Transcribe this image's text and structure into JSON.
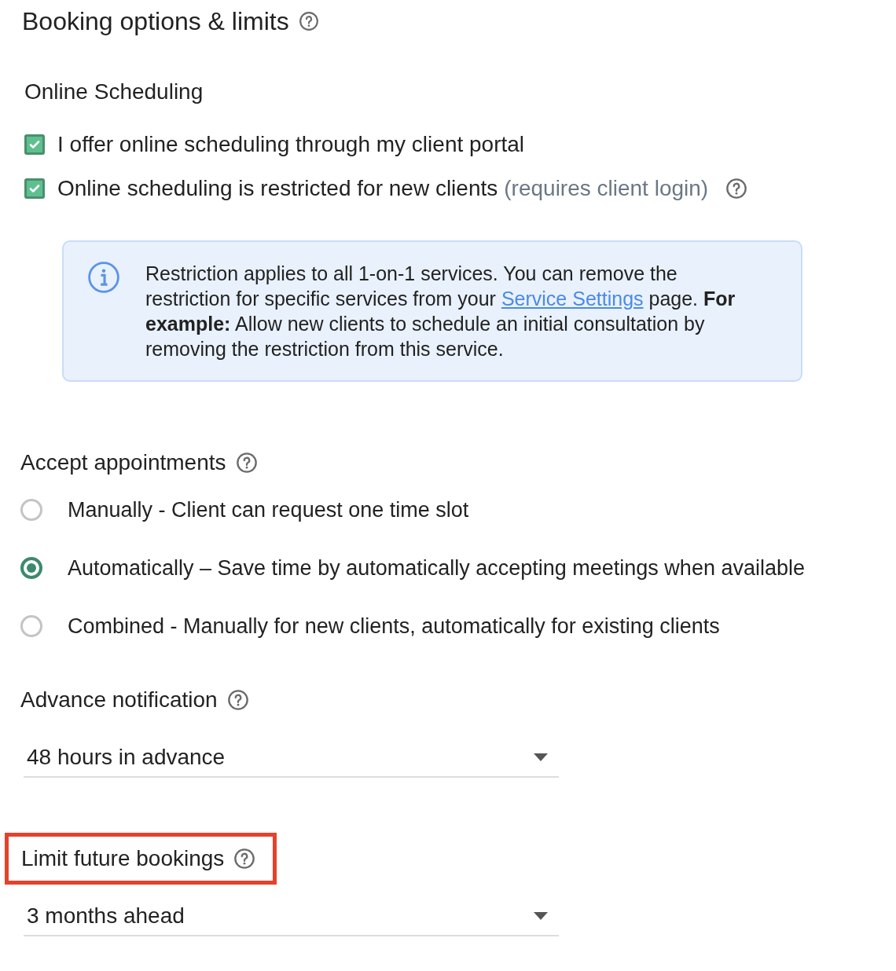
{
  "title": "Booking options & limits",
  "title_help": true,
  "online_scheduling": {
    "heading": "Online Scheduling",
    "checkboxes": [
      {
        "label": "I offer online scheduling through my client portal",
        "checked": true,
        "help": false
      },
      {
        "label": "Online scheduling is restricted for new clients",
        "note": "(requires client login)",
        "checked": true,
        "help": true
      }
    ],
    "info": {
      "text_before": "Restriction applies to all 1-on-1 services. You can remove the restriction for specific services from your",
      "link": "Service Settings",
      "text_after": "page. **For example:** Allow new clients to schedule an initial consultation by removing the restriction from this service."
    }
  },
  "sections": [
    {
      "kind": "radio",
      "heading": "Accept appointments",
      "help": true,
      "highlighted": false,
      "options": [
        {
          "label": "Manually - Client can request one time slot",
          "selected": false
        },
        {
          "label": "Automatically – Save time by automatically accepting meetings when available",
          "selected": true
        },
        {
          "label": "Combined - Manually for new clients, automatically for existing clients",
          "selected": false
        }
      ]
    },
    {
      "kind": "select",
      "heading": "Advance notification",
      "help": true,
      "highlighted": false,
      "value": "48 hours in advance"
    },
    {
      "kind": "select",
      "heading": "Limit future bookings",
      "help": true,
      "highlighted": true,
      "value": "3 months ahead"
    }
  ]
}
